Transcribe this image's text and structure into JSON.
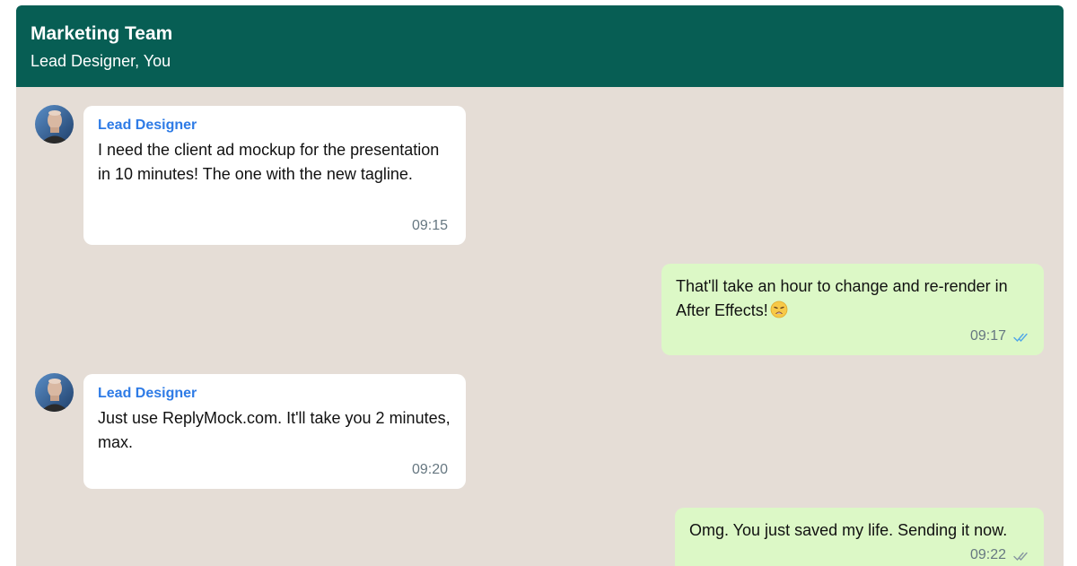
{
  "header": {
    "title": "Marketing Team",
    "subtitle": "Lead Designer, You"
  },
  "messages": [
    {
      "direction": "in",
      "sender": "Lead Designer",
      "text": "I need the client ad mockup for the presentation in 10 minutes! The one with the new tagline.",
      "time": "09:15",
      "avatar_icon": "person-avatar-icon"
    },
    {
      "direction": "out",
      "text": "That'll take an hour to change and re-render in After Effects!",
      "emoji": "weary-face-icon",
      "time": "09:17",
      "status": "read",
      "status_icon": "double-check-icon",
      "status_color": "#4fa6e8"
    },
    {
      "direction": "in",
      "sender": "Lead Designer",
      "text": "Just use ReplyMock.com. It'll take you 2 minutes, max.",
      "time": "09:20",
      "avatar_icon": "person-avatar-icon"
    },
    {
      "direction": "out",
      "text": "Omg. You just saved my life. Sending it now.",
      "time": "09:22",
      "status": "delivered",
      "status_icon": "double-check-icon",
      "status_color": "#8696a0"
    }
  ],
  "colors": {
    "header_bg": "#075e54",
    "chat_bg": "#e5ddd6",
    "incoming_bubble": "#ffffff",
    "outgoing_bubble": "#dcf8c6",
    "sender_name": "#2e7be6"
  }
}
